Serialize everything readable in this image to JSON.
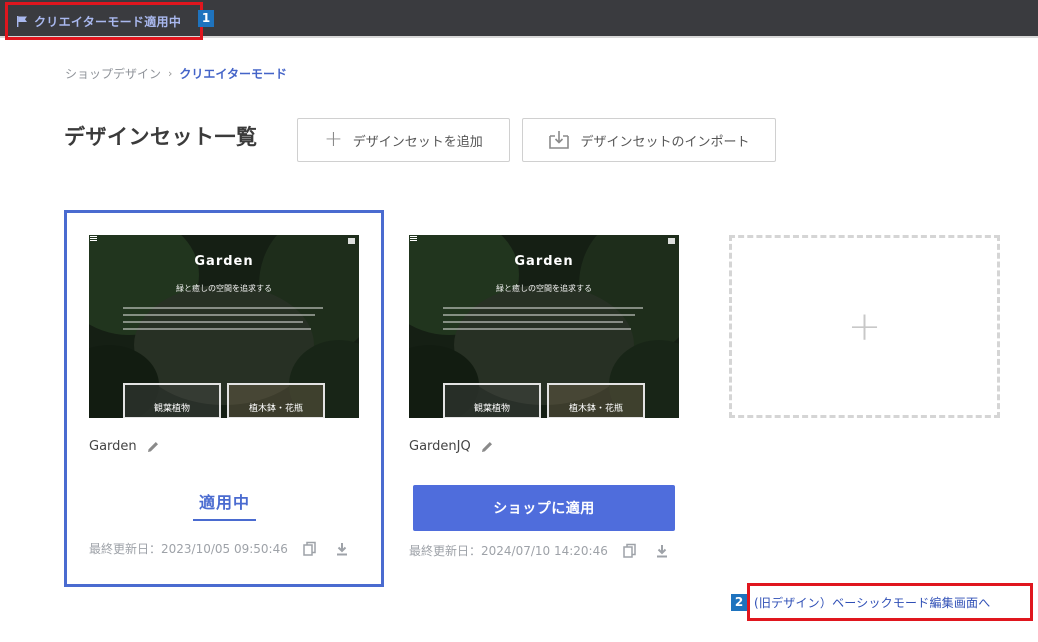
{
  "topbar": {
    "mode_label": "クリエイターモード適用中",
    "flag_icon": "flag-icon",
    "badge_number": "1"
  },
  "breadcrumb": {
    "root": "ショップデザイン",
    "separator": "›",
    "current": "クリエイターモード"
  },
  "page": {
    "title": "デザインセット一覧"
  },
  "toolbar": {
    "add_label": "デザインセットを追加",
    "add_icon": "plus-icon",
    "import_label": "デザインセットのインポート",
    "import_icon": "import-icon"
  },
  "design_sets": [
    {
      "name": "Garden",
      "status": "applied",
      "status_label": "適用中",
      "updated": "最終更新日：2023/10/05 09:50:46",
      "thumbnail": {
        "brand": "Garden",
        "tagline": "緑と癒しの空間を追求する",
        "categories": [
          "観葉植物",
          "植木鉢・花瓶"
        ]
      }
    },
    {
      "name": "GardenJQ",
      "status": "not_applied",
      "apply_label": "ショップに適用",
      "updated": "最終更新日：2024/07/10 14:20:46",
      "thumbnail": {
        "brand": "Garden",
        "tagline": "緑と癒しの空間を追求する",
        "categories": [
          "観葉植物",
          "植木鉢・花瓶"
        ]
      }
    }
  ],
  "add_slot_icon": "plus-icon",
  "legacy": {
    "badge_number": "2",
    "link_label": "(旧デザイン）ベーシックモード編集画面へ"
  },
  "colors": {
    "accent": "#4f6ddc",
    "highlight_border": "#e0161e",
    "topbar_bg": "#3a3b3f",
    "badge": "#1e73be"
  }
}
